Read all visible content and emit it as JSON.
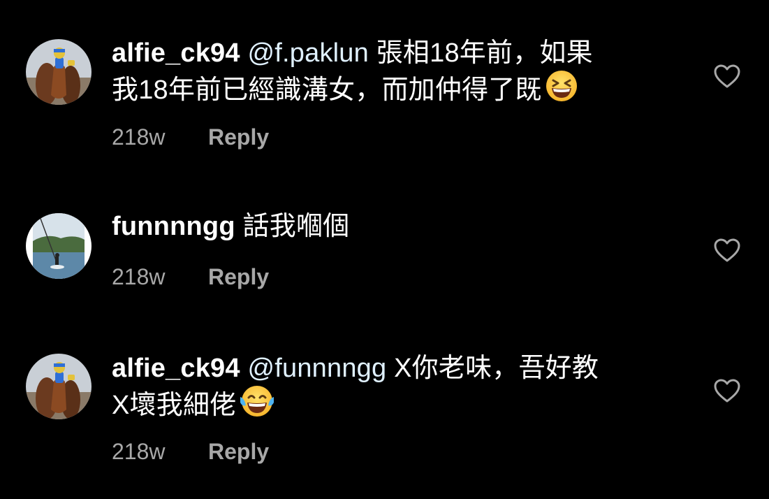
{
  "comments": [
    {
      "username": "alfie_ck94",
      "mention": "@f.paklun",
      "text_line1": "張相18年前，如果",
      "text_line2": "我18年前已經識溝女，而加仲得了既",
      "emoji": "grinning-squinting-face-emoji",
      "time": "218w",
      "reply_label": "Reply",
      "avatar": "jockey-horse-avatar"
    },
    {
      "username": "funnnngg",
      "mention": "",
      "text_line1": "話我嗰個",
      "text_line2": "",
      "emoji": "",
      "time": "218w",
      "reply_label": "Reply",
      "avatar": "wakeboard-lake-avatar"
    },
    {
      "username": "alfie_ck94",
      "mention": "@funnnngg",
      "text_line1": "X你老味，吾好教",
      "text_line2": "X壞我細佬",
      "emoji": "tears-of-joy-emoji",
      "time": "218w",
      "reply_label": "Reply",
      "avatar": "jockey-horse-avatar"
    }
  ],
  "colors": {
    "background": "#000000",
    "text": "#ffffff",
    "mention": "#e0f1ff",
    "meta": "#a8a8a8"
  },
  "icons": {
    "like": "heart-outline-icon"
  }
}
